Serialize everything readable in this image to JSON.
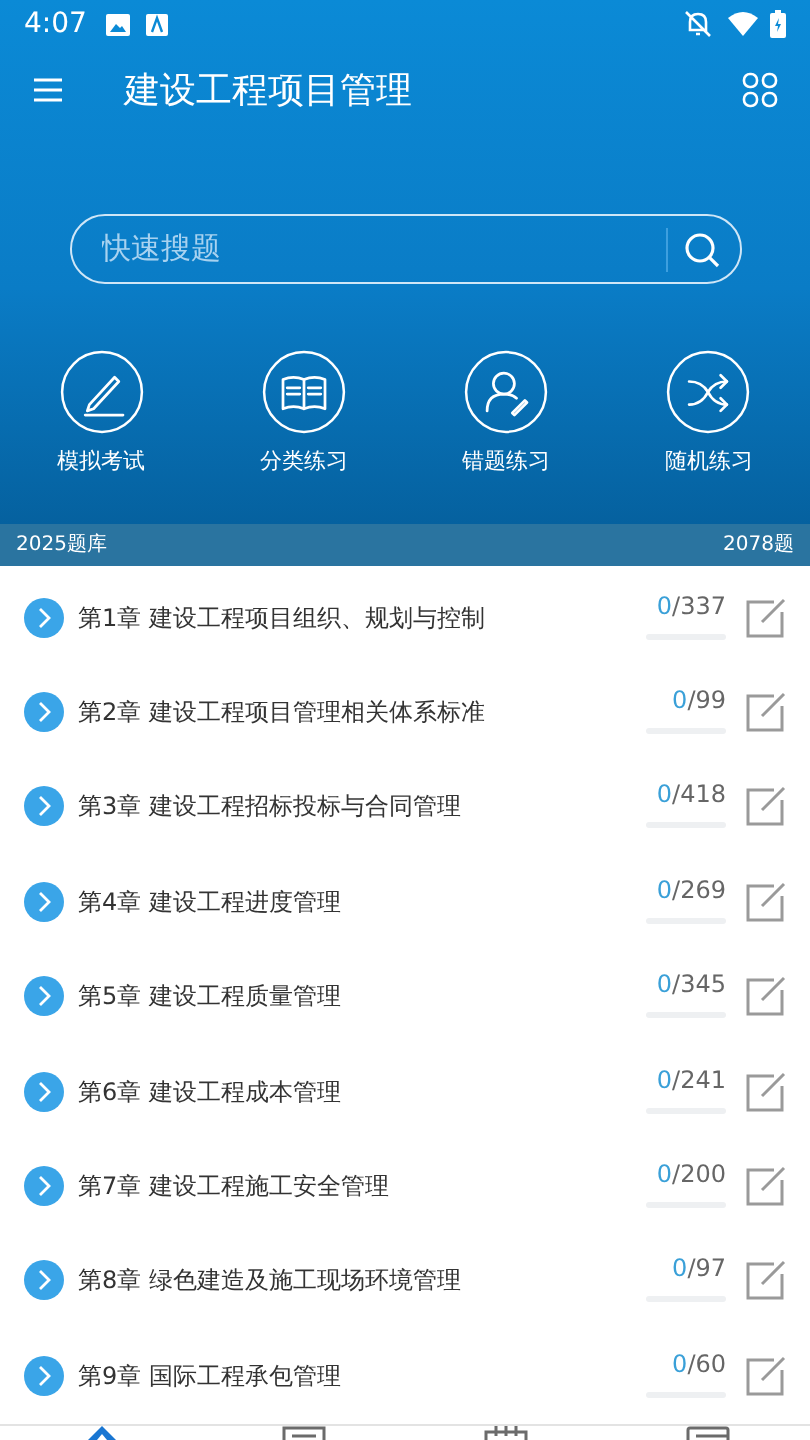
{
  "status_bar": {
    "time": "4:07"
  },
  "header": {
    "title": "建设工程项目管理"
  },
  "search": {
    "placeholder": "快速搜题"
  },
  "actions": [
    {
      "kind": "exam",
      "label": "模拟考试"
    },
    {
      "kind": "category",
      "label": "分类练习"
    },
    {
      "kind": "mistakes",
      "label": "错题练习"
    },
    {
      "kind": "random",
      "label": "随机练习"
    }
  ],
  "bank_bar": {
    "left": "2025题库",
    "right": "2078题"
  },
  "chapters": [
    {
      "title": "第1章 建设工程项目组织、规划与控制",
      "done": "0",
      "total": "/337",
      "level": 0
    },
    {
      "title": "第2章 建设工程项目管理相关体系标准",
      "done": "0",
      "total": "/99",
      "level": 0
    },
    {
      "title": "第3章 建设工程招标投标与合同管理",
      "done": "0",
      "total": "/418",
      "level": 0
    },
    {
      "title": "第4章 建设工程进度管理",
      "done": "0",
      "total": "/269",
      "level": 0
    },
    {
      "title": "第5章 建设工程质量管理",
      "done": "0",
      "total": "/345",
      "level": 0
    },
    {
      "title": "第6章 建设工程成本管理",
      "done": "0",
      "total": "/241",
      "level": 0
    },
    {
      "title": "第7章 建设工程施工安全管理",
      "done": "0",
      "total": "/200",
      "level": 0
    },
    {
      "title": "第8章 绿色建造及施工现场环境管理",
      "done": "0",
      "total": "/97",
      "level": 0
    },
    {
      "title": "第9章 国际工程承包管理",
      "done": "0",
      "total": "/60",
      "level": 0
    }
  ],
  "bottom_nav": [
    {
      "kind": "home",
      "selected": true
    },
    {
      "kind": "list",
      "selected": false
    },
    {
      "kind": "calendar",
      "selected": false
    },
    {
      "kind": "book",
      "selected": false
    }
  ]
}
